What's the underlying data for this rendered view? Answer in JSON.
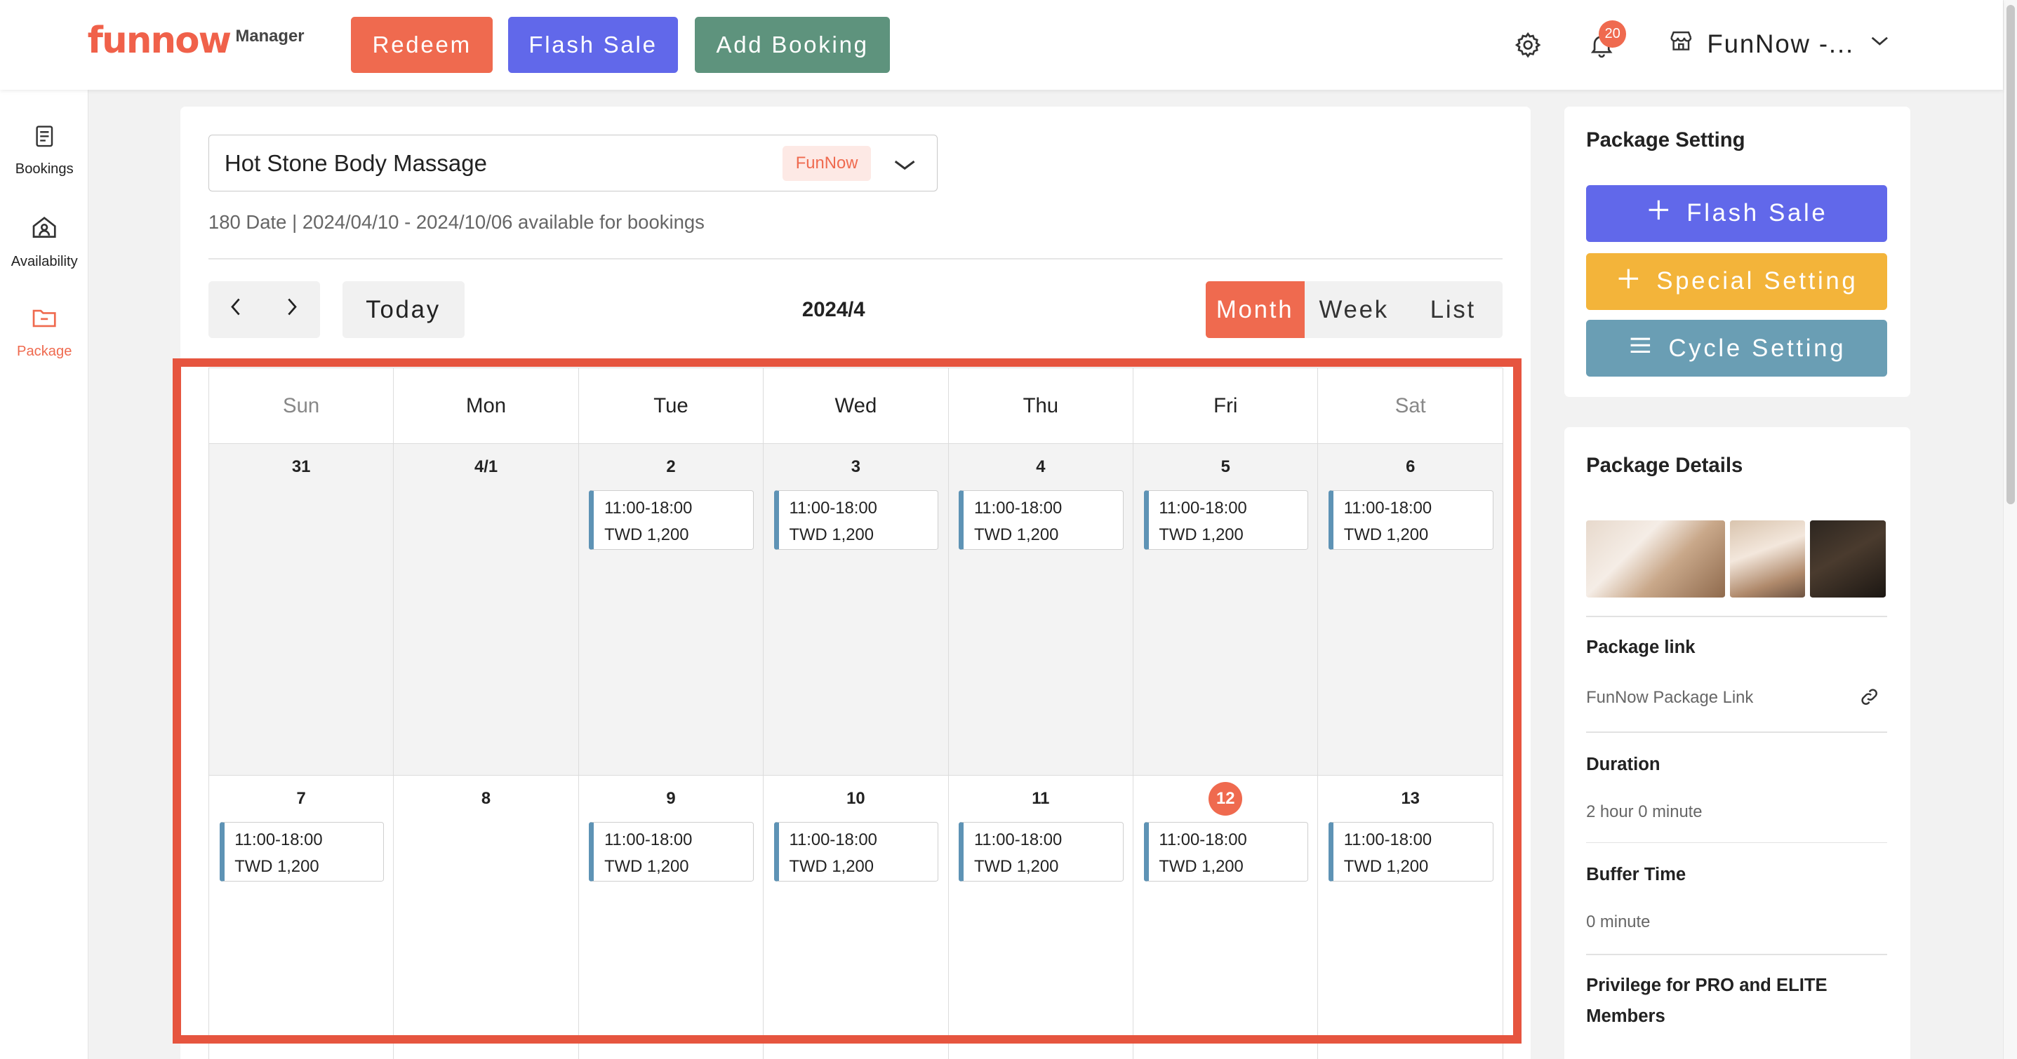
{
  "header": {
    "logo_text": "funnow",
    "logo_sub": "Manager",
    "redeem_label": "Redeem",
    "flash_sale_label": "Flash Sale",
    "add_booking_label": "Add Booking",
    "notification_count": "20",
    "store_name": "FunNow -..."
  },
  "sidebar": {
    "items": [
      {
        "label": "Bookings",
        "icon": "document-icon"
      },
      {
        "label": "Availability",
        "icon": "person-house-icon"
      },
      {
        "label": "Package",
        "icon": "folder-icon",
        "active": true
      }
    ]
  },
  "package_select": {
    "value": "Hot Stone Body Massage",
    "tag": "FunNow"
  },
  "availability_text": "180 Date | 2024/04/10 - 2024/10/06 available for bookings",
  "calendar": {
    "today_label": "Today",
    "title": "2024/4",
    "views": [
      "Month",
      "Week",
      "List"
    ],
    "active_view": "Month",
    "days": [
      "Sun",
      "Mon",
      "Tue",
      "Wed",
      "Thu",
      "Fri",
      "Sat"
    ],
    "week1": [
      {
        "day": "31",
        "time": "",
        "price": ""
      },
      {
        "day": "4/1",
        "time": "",
        "price": ""
      },
      {
        "day": "2",
        "time": "11:00-18:00",
        "price": "TWD 1,200"
      },
      {
        "day": "3",
        "time": "11:00-18:00",
        "price": "TWD 1,200"
      },
      {
        "day": "4",
        "time": "11:00-18:00",
        "price": "TWD 1,200"
      },
      {
        "day": "5",
        "time": "11:00-18:00",
        "price": "TWD 1,200"
      },
      {
        "day": "6",
        "time": "11:00-18:00",
        "price": "TWD 1,200"
      }
    ],
    "week2": [
      {
        "day": "7",
        "time": "11:00-18:00",
        "price": "TWD 1,200"
      },
      {
        "day": "8",
        "time": "",
        "price": ""
      },
      {
        "day": "9",
        "time": "11:00-18:00",
        "price": "TWD 1,200"
      },
      {
        "day": "10",
        "time": "11:00-18:00",
        "price": "TWD 1,200"
      },
      {
        "day": "11",
        "time": "11:00-18:00",
        "price": "TWD 1,200"
      },
      {
        "day": "12",
        "time": "11:00-18:00",
        "price": "TWD 1,200",
        "today": true
      },
      {
        "day": "13",
        "time": "11:00-18:00",
        "price": "TWD 1,200"
      }
    ]
  },
  "package_setting": {
    "title": "Package Setting",
    "flash_sale_label": "Flash Sale",
    "special_setting_label": "Special Setting",
    "cycle_setting_label": "Cycle Setting"
  },
  "package_details": {
    "title": "Package Details",
    "link_label": "Package link",
    "link_value": "FunNow Package Link",
    "duration_label": "Duration",
    "duration_value": "2 hour 0 minute",
    "buffer_label": "Buffer Time",
    "buffer_value": "0 minute",
    "privilege_label": "Privilege for PRO and ELITE Members"
  },
  "colors": {
    "accent": "#ef6a4f",
    "flash": "#6168ea",
    "add_booking": "#5e937d",
    "special": "#f3b43a",
    "cycle": "#6a9eb4",
    "slot_bar": "#5e93b5"
  }
}
